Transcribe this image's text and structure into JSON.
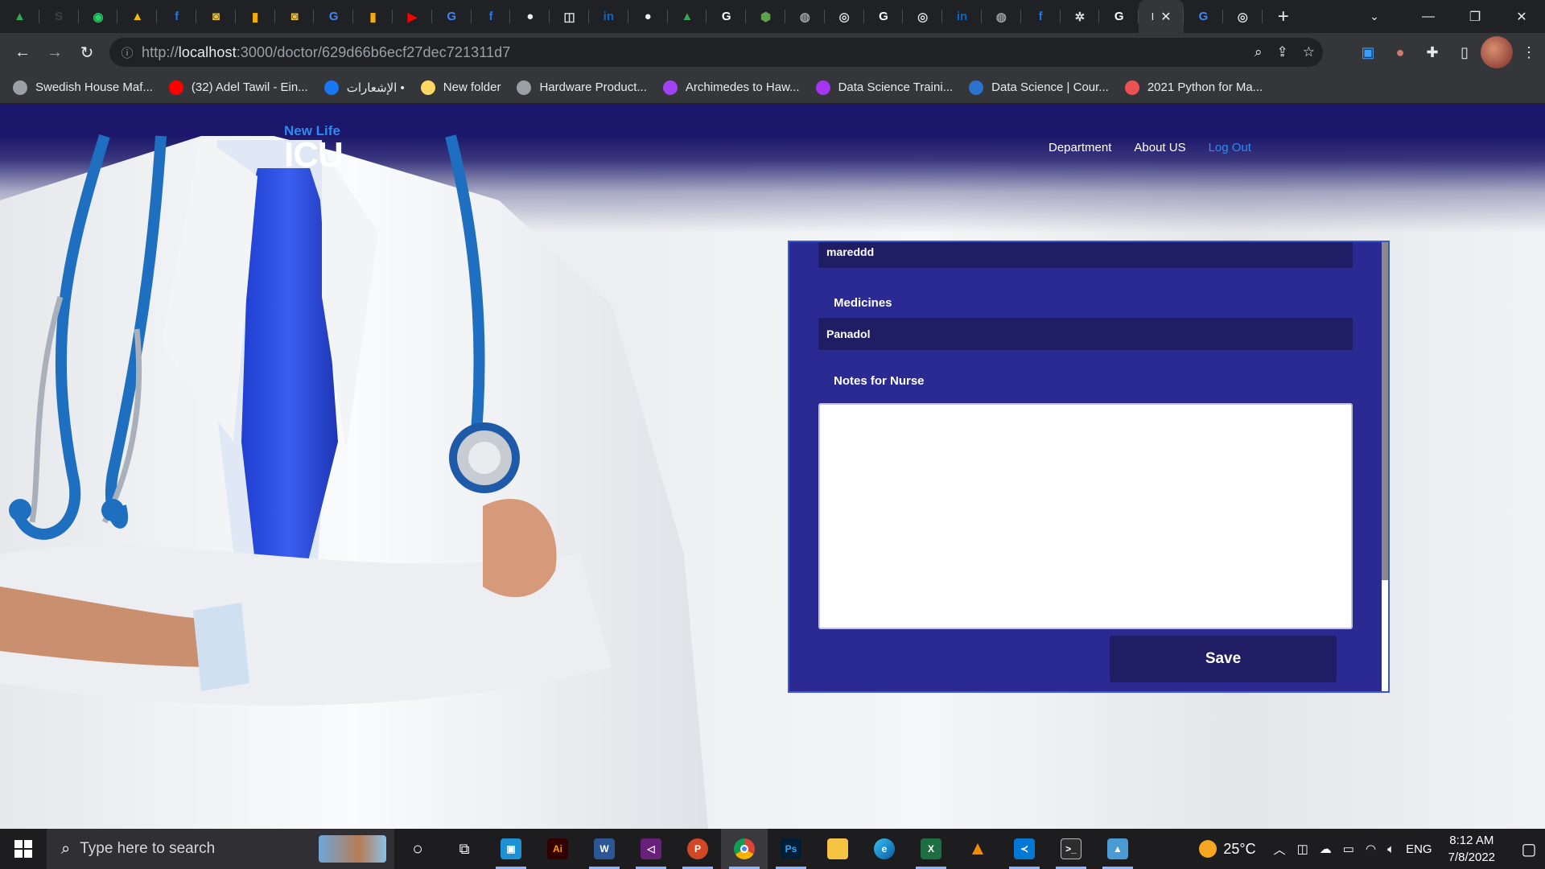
{
  "browser": {
    "tabs": [
      {
        "icon": "google-drive-icon",
        "color": "#34a853",
        "glyph": "▲"
      },
      {
        "icon": "smc-icon",
        "color": "#3c4043",
        "glyph": "S"
      },
      {
        "icon": "whatsapp-icon",
        "color": "#25d366",
        "glyph": "◉"
      },
      {
        "icon": "google-drive-icon",
        "color": "#fbbc04",
        "glyph": "▲"
      },
      {
        "icon": "facebook-icon",
        "color": "#1877f2",
        "glyph": "f"
      },
      {
        "icon": "yellow-app-icon",
        "color": "#e9c23a",
        "glyph": "◙"
      },
      {
        "icon": "chart-icon",
        "color": "#f9ab00",
        "glyph": "▮"
      },
      {
        "icon": "yellow-app-icon",
        "color": "#e9c23a",
        "glyph": "◙"
      },
      {
        "icon": "translate-icon",
        "color": "#4285f4",
        "glyph": "G"
      },
      {
        "icon": "chart-icon",
        "color": "#f9ab00",
        "glyph": "▮"
      },
      {
        "icon": "youtube-icon",
        "color": "#ff0000",
        "glyph": "▶"
      },
      {
        "icon": "translate-icon",
        "color": "#4285f4",
        "glyph": "G"
      },
      {
        "icon": "facebook-icon",
        "color": "#1877f2",
        "glyph": "f"
      },
      {
        "icon": "github-icon",
        "color": "#f0f0f0",
        "glyph": "●"
      },
      {
        "icon": "app-icon",
        "color": "#dadce0",
        "glyph": "◫"
      },
      {
        "icon": "linkedin-icon",
        "color": "#0a66c2",
        "glyph": "in"
      },
      {
        "icon": "github-icon",
        "color": "#f0f0f0",
        "glyph": "●"
      },
      {
        "icon": "google-drive-icon",
        "color": "#34a853",
        "glyph": "▲"
      },
      {
        "icon": "google-icon",
        "color": "#ffffff",
        "glyph": "G"
      },
      {
        "icon": "nodejs-icon",
        "color": "#5fa04e",
        "glyph": "⬢"
      },
      {
        "icon": "globe-icon",
        "color": "#9aa0a6",
        "glyph": "◍"
      },
      {
        "icon": "chrome-icon",
        "color": "#dadce0",
        "glyph": "◎"
      },
      {
        "icon": "google-icon",
        "color": "#ffffff",
        "glyph": "G"
      },
      {
        "icon": "chrome-icon",
        "color": "#dadce0",
        "glyph": "◎"
      },
      {
        "icon": "linkedin-icon",
        "color": "#0a66c2",
        "glyph": "in"
      },
      {
        "icon": "globe-icon",
        "color": "#9aa0a6",
        "glyph": "◍"
      },
      {
        "icon": "facebook-icon",
        "color": "#1877f2",
        "glyph": "f"
      },
      {
        "icon": "openai-icon",
        "color": "#dadce0",
        "glyph": "✲"
      },
      {
        "icon": "google-icon",
        "color": "#ffffff",
        "glyph": "G"
      }
    ],
    "active_tab_text": "I",
    "after_tabs": [
      {
        "icon": "translate-icon",
        "color": "#4285f4",
        "glyph": "G"
      },
      {
        "icon": "chrome-icon",
        "color": "#dadce0",
        "glyph": "◎"
      }
    ],
    "url_prefix": "http://",
    "url_host": "localhost",
    "url_path": ":3000/doctor/629d66b6ecf27dec721311d7",
    "bookmarks": [
      {
        "label": "Swedish House Maf...",
        "icon": "globe-icon",
        "color": "#9aa0a6"
      },
      {
        "label": "(32) Adel Tawil - Ein...",
        "icon": "youtube-icon",
        "color": "#ff0000"
      },
      {
        "label": "الإشعارات •",
        "icon": "facebook-icon",
        "color": "#1877f2"
      },
      {
        "label": "New folder",
        "icon": "folder-icon",
        "color": "#fdd663"
      },
      {
        "label": "Hardware Product...",
        "icon": "apple-icon",
        "color": "#9aa0a6"
      },
      {
        "label": "Archimedes to Haw...",
        "icon": "feather-icon",
        "color": "#a142f4"
      },
      {
        "label": "Data Science Traini...",
        "icon": "udemy-icon",
        "color": "#a435f0"
      },
      {
        "label": "Data Science | Cour...",
        "icon": "coursera-icon",
        "color": "#2a73cc"
      },
      {
        "label": "2021 Python for Ma...",
        "icon": "udemy-icon",
        "color": "#ec5252"
      }
    ]
  },
  "site": {
    "logo_sub": "New Life",
    "logo_main": "ICU",
    "nav": {
      "department": "Department",
      "about": "About US",
      "logout": "Log Out"
    }
  },
  "form": {
    "diagnosis_value": "mareddd",
    "medicines_label": "Medicines",
    "medicines_value": "Panadol",
    "notes_label": "Notes for Nurse",
    "notes_value": "",
    "save_label": "Save"
  },
  "taskbar": {
    "search_placeholder": "Type here to search",
    "temperature": "25°C",
    "language": "ENG",
    "time": "8:12 AM",
    "date": "7/8/2022"
  }
}
